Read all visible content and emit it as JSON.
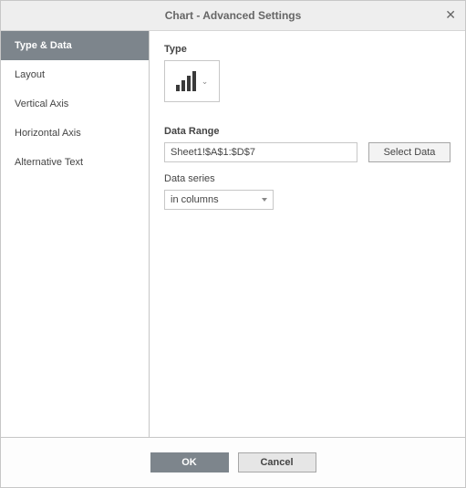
{
  "title": "Chart - Advanced Settings",
  "sidebar": {
    "items": [
      {
        "label": "Type & Data",
        "active": true
      },
      {
        "label": "Layout",
        "active": false
      },
      {
        "label": "Vertical Axis",
        "active": false
      },
      {
        "label": "Horizontal Axis",
        "active": false
      },
      {
        "label": "Alternative Text",
        "active": false
      }
    ]
  },
  "content": {
    "type_label": "Type",
    "chart_type_icon": "bar-chart",
    "data_range_label": "Data Range",
    "data_range_value": "Sheet1!$A$1:$D$7",
    "select_data_label": "Select Data",
    "data_series_label": "Data series",
    "data_series_value": "in columns"
  },
  "footer": {
    "ok": "OK",
    "cancel": "Cancel"
  }
}
